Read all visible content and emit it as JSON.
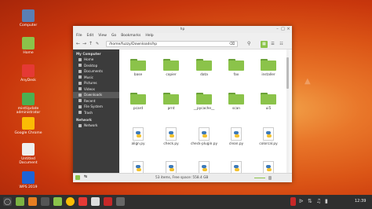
{
  "desktop": {
    "icons": [
      {
        "label": "Computer",
        "icon": "monitor-icon",
        "color": "#5b7fb4"
      },
      {
        "label": "Home",
        "icon": "home-folder-icon",
        "color": "#8bc34a"
      },
      {
        "label": "AnyDesk",
        "icon": "anydesk-icon",
        "color": "#e53935"
      },
      {
        "label": "mintUpdate administrator",
        "icon": "shield-icon",
        "color": "#4caf50"
      },
      {
        "label": "Google Chrome",
        "icon": "chrome-icon",
        "color": "#fbbc05"
      },
      {
        "label": "Untitled Document",
        "icon": "document-icon",
        "color": "#eeeeee"
      },
      {
        "label": "WPS 2019",
        "icon": "wps-icon",
        "color": "#1e63d5"
      }
    ]
  },
  "window": {
    "title": "hp",
    "menu": [
      "File",
      "Edit",
      "View",
      "Go",
      "Bookmarks",
      "Help"
    ],
    "path": "/home/fuzzy/Downloads/hp",
    "sidebar": {
      "sections": [
        {
          "heading": "My Computer",
          "items": [
            "Home",
            "Desktop",
            "Documents",
            "Music",
            "Pictures",
            "Videos",
            "Downloads",
            "Recent",
            "File System",
            "Trash"
          ]
        },
        {
          "heading": "Network",
          "items": [
            "Network"
          ]
        }
      ],
      "selected": "Downloads"
    },
    "files": [
      {
        "name": "base",
        "type": "folder"
      },
      {
        "name": "copier",
        "type": "folder"
      },
      {
        "name": "data",
        "type": "folder"
      },
      {
        "name": "fax",
        "type": "folder"
      },
      {
        "name": "installer",
        "type": "folder"
      },
      {
        "name": "pcard",
        "type": "folder"
      },
      {
        "name": "prnt",
        "type": "folder"
      },
      {
        "name": "__pycache__",
        "type": "folder"
      },
      {
        "name": "scan",
        "type": "folder"
      },
      {
        "name": "ui5",
        "type": "folder"
      },
      {
        "name": "align.py",
        "type": "python"
      },
      {
        "name": "check.py",
        "type": "python"
      },
      {
        "name": "check-plugin.py",
        "type": "python"
      },
      {
        "name": "clean.py",
        "type": "python"
      },
      {
        "name": "colorcal.py",
        "type": "python"
      },
      {
        "name": "",
        "type": "python"
      },
      {
        "name": "",
        "type": "python"
      },
      {
        "name": "",
        "type": "python"
      },
      {
        "name": "",
        "type": "python"
      },
      {
        "name": "",
        "type": "python"
      }
    ],
    "status": "53 items, Free space: 558.4 GB"
  },
  "taskbar": {
    "clock": "12:39"
  }
}
